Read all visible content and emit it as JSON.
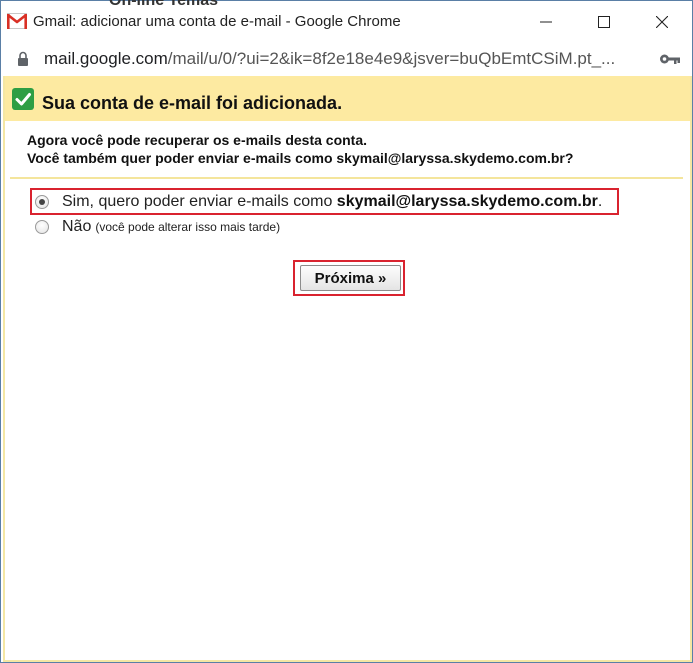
{
  "window": {
    "title": "Gmail: adicionar uma conta de e-mail - Google Chrome",
    "background_peek_text": "On-line   Temas"
  },
  "addressbar": {
    "url_domain": "mail.google.com",
    "url_path": "/mail/u/0/?ui=2&ik=8f2e18e4e9&jsver=buQbEmtCSiM.pt_..."
  },
  "banner": {
    "title": "Sua conta de e-mail foi adicionada."
  },
  "notice": {
    "line1": "Agora você pode recuperar os e-mails desta conta.",
    "line2": "Você também quer poder enviar e-mails como skymail@laryssa.skydemo.com.br?"
  },
  "options": {
    "yes_label": "Sim, quero poder enviar e-mails como",
    "yes_email": "skymail@laryssa.skydemo.com.br",
    "yes_period": ".",
    "no_label": "Não",
    "no_note": "(você pode alterar isso mais tarde)",
    "selected": "yes"
  },
  "actions": {
    "next_label": "Próxima »"
  },
  "colors": {
    "banner_bg": "#fdeaa1",
    "highlight": "#d9232f",
    "check_green": "#2e9e44",
    "gmail_red": "#d93025"
  },
  "icons": {
    "app": "gmail-icon",
    "security": "lock-icon",
    "passwords": "key-icon",
    "success": "check-icon"
  }
}
